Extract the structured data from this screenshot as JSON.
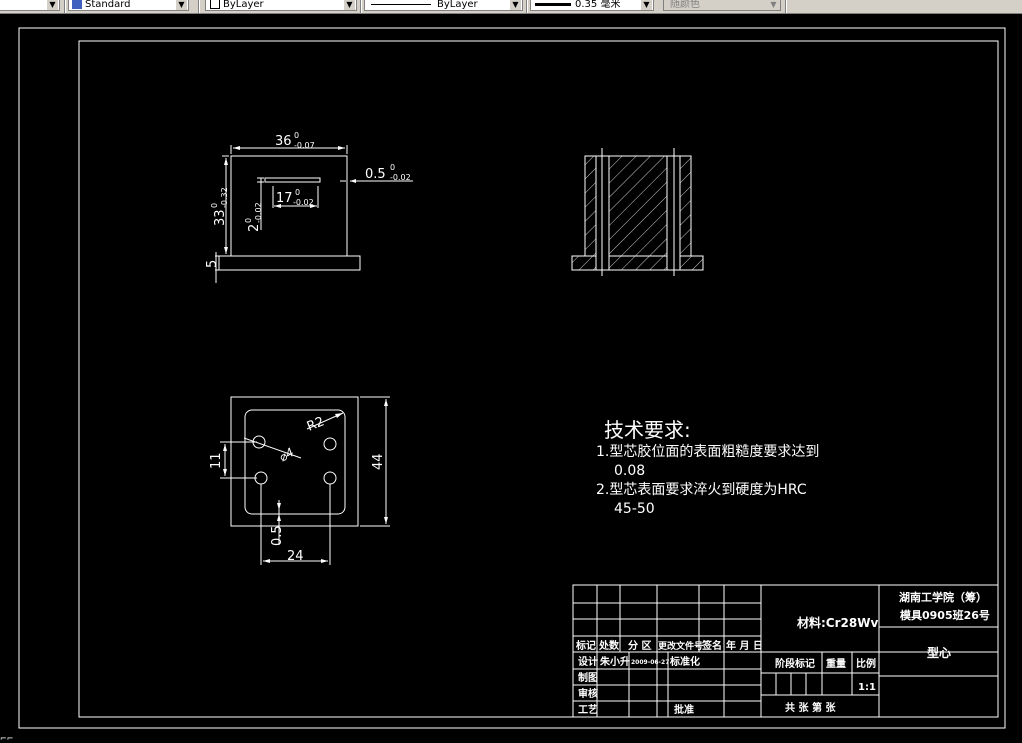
{
  "toolbar": {
    "text_style": "Standard",
    "color": "ByLayer",
    "linetype": "ByLayer",
    "lineweight_value": "0.35",
    "lineweight_unit": "毫米",
    "plot_style": "随颜色"
  },
  "drawing": {
    "dims": {
      "d36": "36",
      "d36_up": "0",
      "d36_low": "-0.07",
      "d05": "0.5",
      "d05_up": "0",
      "d05_low": "-0.02",
      "d17": "17",
      "d17_up": "0",
      "d17_low": "-0.02",
      "d33": "33",
      "d33_up": "0",
      "d33_low": "-0.32",
      "d2": "2",
      "d2_up": "0",
      "d2_low": "-0.02",
      "d5": "5",
      "r2": "R2",
      "phi4": "⌀4",
      "d11": "11",
      "d44": "44",
      "d05b": "0.5",
      "d24": "24"
    },
    "tech_req": {
      "title": "技术要求:",
      "line1": "1.型芯胶位面的表面粗糙度要求达到",
      "line1b": "0.08",
      "line2": "2.型芯表面要求淬火到硬度为HRC",
      "line2b": "45-50"
    },
    "title_block": {
      "material": "材料:Cr28Wv",
      "school": "湖南工学院（筹）",
      "class_id": "模具0905班26号",
      "part_name": "型心",
      "h_mark": "标记",
      "h_count": "处数",
      "h_zone": "分 区",
      "h_docno": "更改文件号",
      "h_sign": "签名",
      "h_date": "年 月 日",
      "designer_label": "设计",
      "designer": "朱小升",
      "design_date": "2009-06-27",
      "standardize": "标准化",
      "draw_label": "制图",
      "check_label": "审核",
      "process_label": "工艺",
      "approve_label": "批准",
      "stage_label": "阶段标记",
      "weight_label": "重量",
      "scale_label": "比例",
      "scale": "1:1",
      "sheets": "共  张  第  张"
    }
  }
}
